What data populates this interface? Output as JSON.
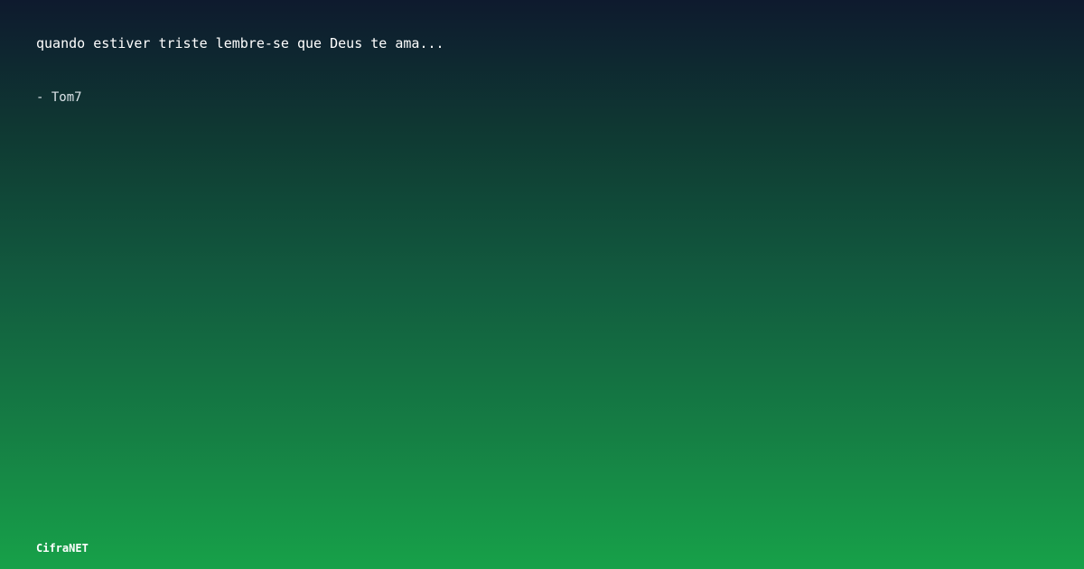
{
  "card": {
    "quote": "quando estiver triste lembre-se que Deus te ama...",
    "author": "- Tom7",
    "brand": "CifraNET"
  },
  "colors": {
    "gradient_top": "#0e1a2e",
    "gradient_bottom": "#17a149",
    "text": "#ffffff"
  }
}
